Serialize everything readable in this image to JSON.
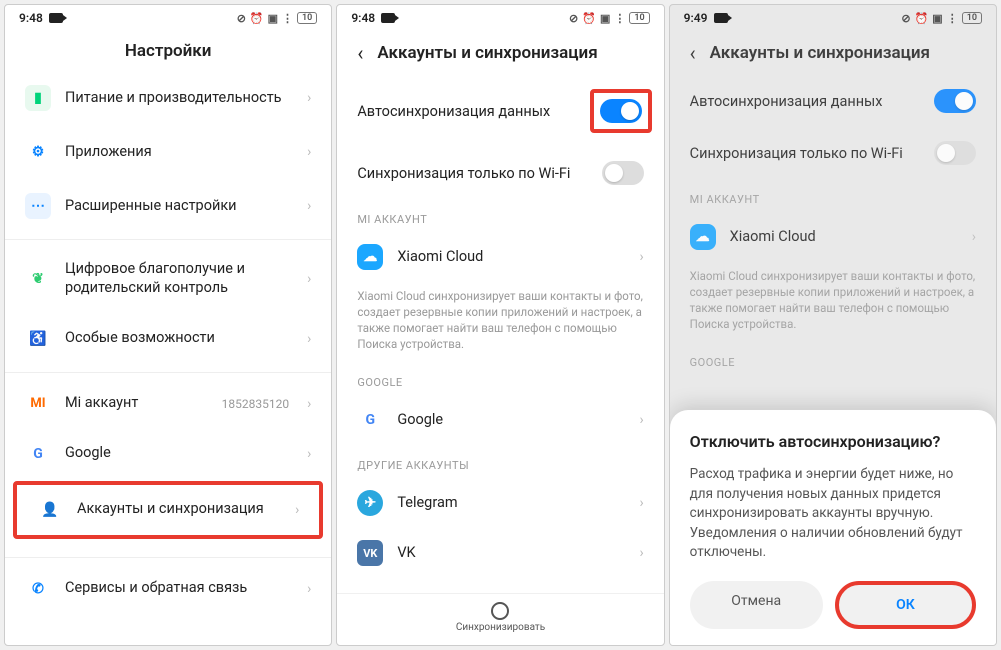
{
  "status": {
    "time1": "9:48",
    "time2": "9:48",
    "time3": "9:49",
    "battery": "10"
  },
  "screen1": {
    "title": "Настройки",
    "items": {
      "power": "Питание и производительность",
      "apps": "Приложения",
      "advanced": "Расширенные настройки",
      "wellbeing": "Цифровое благополучие и родительский контроль",
      "accessibility": "Особые возможности",
      "miacct": "Mi аккаунт",
      "miacct_id": "1852835120",
      "google": "Google",
      "accounts_sync": "Аккаунты и синхронизация",
      "feedback": "Сервисы и обратная связь"
    }
  },
  "screen2": {
    "title": "Аккаунты и синхронизация",
    "autosync": "Автосинхронизация данных",
    "wifi_only": "Синхронизация только по Wi-Fi",
    "sec_mi": "MI АККАУНТ",
    "xiaomi_cloud": "Xiaomi Cloud",
    "cloud_desc": "Xiaomi Cloud синхронизирует ваши контакты и фото, создает резервные копии приложений и настроек, а также помогает найти ваш телефон с помощью Поиска устройства.",
    "sec_google": "GOOGLE",
    "google": "Google",
    "sec_other": "ДРУГИЕ АККАУНТЫ",
    "telegram": "Telegram",
    "vk": "VK",
    "footer": "Синхронизировать"
  },
  "screen3": {
    "title": "Аккаунты и синхронизация",
    "autosync": "Автосинхронизация данных",
    "wifi_only": "Синхронизация только по Wi-Fi",
    "sec_mi": "MI АККАУНТ",
    "xiaomi_cloud": "Xiaomi Cloud",
    "cloud_desc": "Xiaomi Cloud синхронизирует ваши контакты и фото, создает резервные копии приложений и настроек, а также помогает найти ваш телефон с помощью Поиска устройства.",
    "sec_google": "GOOGLE",
    "modal_title": "Отключить автосинхронизацию?",
    "modal_body": "Расход трафика и энергии будет ниже, но для получения новых данных придется синхронизировать аккаунты вручную. Уведомления о наличии обновлений будут отключены.",
    "cancel": "Отмена",
    "ok": "ОК"
  },
  "colors": {
    "accent": "#0a84ff",
    "highlight": "#e83a2e"
  }
}
